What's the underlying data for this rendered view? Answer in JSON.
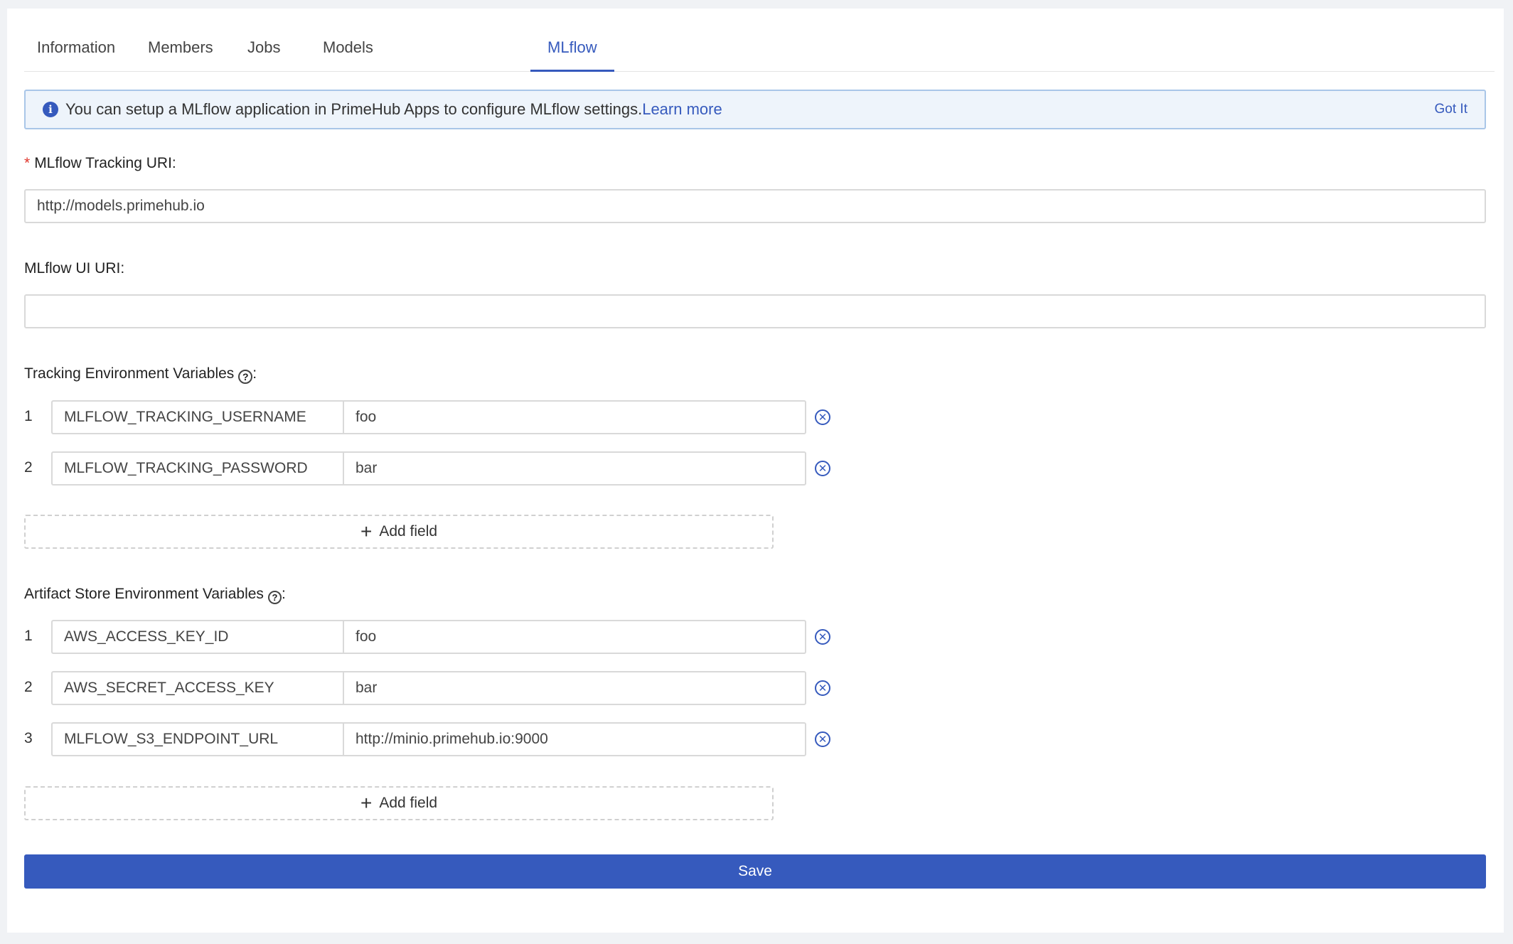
{
  "tabs": [
    {
      "label": "Information"
    },
    {
      "label": "Members"
    },
    {
      "label": "Jobs"
    },
    {
      "label": "Models"
    },
    {
      "label": "MLflow"
    }
  ],
  "active_tab": "MLflow",
  "alert": {
    "text": "You can setup a MLflow application in PrimeHub Apps to configure MLflow settings.",
    "link": "Learn more",
    "dismiss": "Got It"
  },
  "tracking_uri": {
    "label": "MLflow Tracking URI",
    "value": "http://models.primehub.io",
    "required_mark": "*"
  },
  "ui_uri": {
    "label": "MLflow UI URI",
    "value": ""
  },
  "tracking_env": {
    "label": "Tracking Environment Variables",
    "rows": [
      {
        "num": "1",
        "key": "MLFLOW_TRACKING_USERNAME",
        "value": "foo"
      },
      {
        "num": "2",
        "key": "MLFLOW_TRACKING_PASSWORD",
        "value": "bar"
      }
    ],
    "add_label": "Add field"
  },
  "artifact_env": {
    "label": "Artifact Store Environment Variables",
    "rows": [
      {
        "num": "1",
        "key": "AWS_ACCESS_KEY_ID",
        "value": "foo"
      },
      {
        "num": "2",
        "key": "AWS_SECRET_ACCESS_KEY",
        "value": "bar"
      },
      {
        "num": "3",
        "key": "MLFLOW_S3_ENDPOINT_URL",
        "value": "http://minio.primehub.io:9000"
      }
    ],
    "add_label": "Add field"
  },
  "save_label": "Save",
  "colors": {
    "accent": "#365abd",
    "required": "#e0362c",
    "alert_bg": "#eef4fb"
  }
}
